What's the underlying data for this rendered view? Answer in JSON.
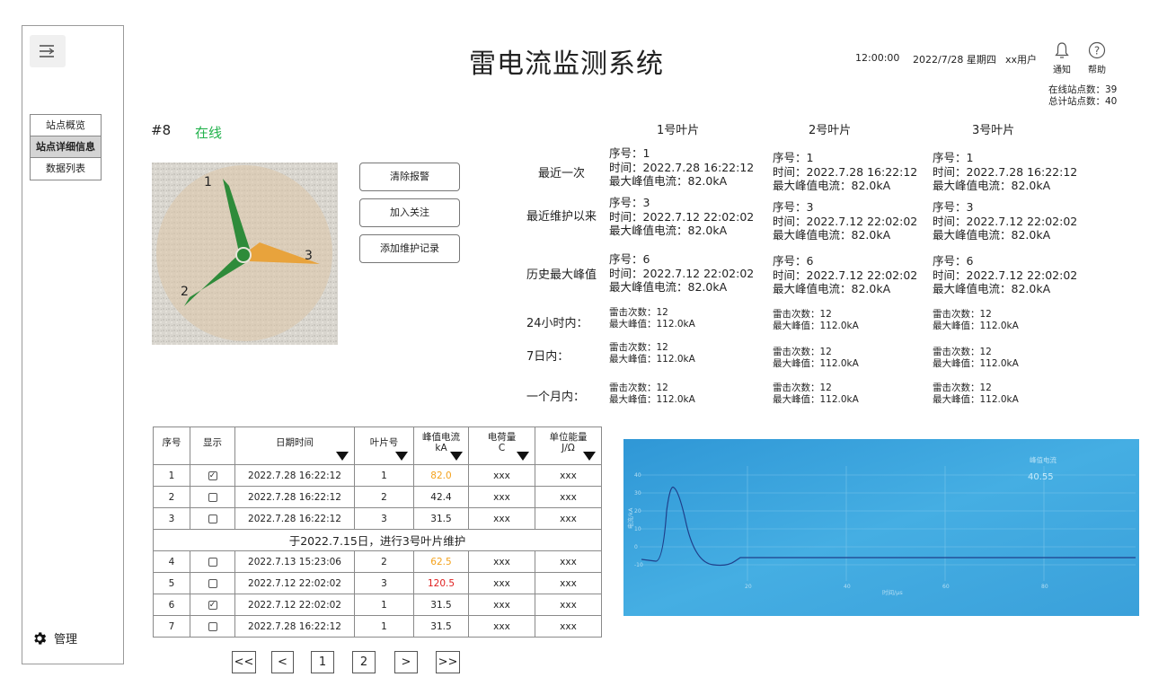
{
  "app": {
    "title": "雷电流监测系统"
  },
  "header": {
    "time": "12:00:00",
    "date": "2022/7/28 星期四",
    "user": "xx用户",
    "notify_label": "通知",
    "help_label": "帮助",
    "online_count": "在线站点数：39",
    "total_count": "总计站点数：40"
  },
  "sidebar": {
    "items": [
      {
        "label": "站点概览"
      },
      {
        "label": "站点详细信息"
      },
      {
        "label": "数据列表"
      }
    ],
    "manage_label": "管理"
  },
  "station": {
    "id": "#8",
    "status": "在线",
    "status_color": "#22b24c"
  },
  "turbine": {
    "blade_labels": [
      "1",
      "2",
      "3"
    ],
    "highlight_blade": "3",
    "normal_color": "#2e8b3a",
    "alert_color": "#e8a33c"
  },
  "actions": {
    "clear_alarm": "清除报警",
    "follow": "加入关注",
    "add_maintenance": "添加维护记录"
  },
  "summary": {
    "blade_headers": [
      "1号叶片",
      "2号叶片",
      "3号叶片"
    ],
    "row_labels": {
      "recent": "最近一次",
      "since_maint": "最近维护以来",
      "hist_max": "历史最大峰值",
      "h24": "24小时内：",
      "d7": "7日内：",
      "m1": "一个月内："
    },
    "blades": [
      {
        "recent": {
          "seq": "序号：1",
          "time": "时间：2022.7.28 16:22:12",
          "peak": "最大峰值电流：82.0kA"
        },
        "since_maint": {
          "seq": "序号：3",
          "time": "时间：2022.7.12 22:02:02",
          "peak": "最大峰值电流：82.0kA"
        },
        "hist_max": {
          "seq": "序号：6",
          "time": "时间：2022.7.12 22:02:02",
          "peak": "最大峰值电流：82.0kA"
        },
        "h24": {
          "count": "雷击次数：12",
          "peak": "最大峰值：112.0kA"
        },
        "d7": {
          "count": "雷击次数：12",
          "peak": "最大峰值：112.0kA"
        },
        "m1": {
          "count": "雷击次数：12",
          "peak": "最大峰值：112.0kA"
        }
      },
      {
        "recent": {
          "seq": "序号：1",
          "time": "时间：2022.7.28 16:22:12",
          "peak": "最大峰值电流：82.0kA"
        },
        "since_maint": {
          "seq": "序号：3",
          "time": "时间：2022.7.12 22:02:02",
          "peak": "最大峰值电流：82.0kA"
        },
        "hist_max": {
          "seq": "序号：6",
          "time": "时间：2022.7.12 22:02:02",
          "peak": "最大峰值电流：82.0kA"
        },
        "h24": {
          "count": "雷击次数：12",
          "peak": "最大峰值：112.0kA"
        },
        "d7": {
          "count": "雷击次数：12",
          "peak": "最大峰值：112.0kA"
        },
        "m1": {
          "count": "雷击次数：12",
          "peak": "最大峰值：112.0kA"
        }
      },
      {
        "recent": {
          "seq": "序号：1",
          "time": "时间：2022.7.28 16:22:12",
          "peak": "最大峰值电流：82.0kA"
        },
        "since_maint": {
          "seq": "序号：3",
          "time": "时间：2022.7.12 22:02:02",
          "peak": "最大峰值电流：82.0kA"
        },
        "hist_max": {
          "seq": "序号：6",
          "time": "时间：2022.7.12 22:02:02",
          "peak": "最大峰值电流：82.0kA"
        },
        "h24": {
          "count": "雷击次数：12",
          "peak": "最大峰值：112.0kA"
        },
        "d7": {
          "count": "雷击次数：12",
          "peak": "最大峰值：112.0kA"
        },
        "m1": {
          "count": "雷击次数：12",
          "peak": "最大峰值：112.0kA"
        }
      }
    ]
  },
  "table": {
    "headers": {
      "seq": "序号",
      "show": "显示",
      "datetime": "日期时间",
      "blade": "叶片号",
      "peak": [
        "峰值电流",
        "kA"
      ],
      "charge": [
        "电荷量",
        "C"
      ],
      "energy": [
        "单位能量",
        "J/Ω"
      ]
    },
    "rows_before": [
      {
        "seq": "1",
        "checked": true,
        "datetime": "2022.7.28 16:22:12",
        "blade": "1",
        "peak": "82.0",
        "level": "orange",
        "charge": "xxx",
        "energy": "xxx"
      },
      {
        "seq": "2",
        "checked": false,
        "datetime": "2022.7.28 16:22:12",
        "blade": "2",
        "peak": "42.4",
        "level": "normal",
        "charge": "xxx",
        "energy": "xxx"
      },
      {
        "seq": "3",
        "checked": false,
        "datetime": "2022.7.28 16:22:12",
        "blade": "3",
        "peak": "31.5",
        "level": "normal",
        "charge": "xxx",
        "energy": "xxx"
      }
    ],
    "maintenance_note": "于2022.7.15日，进行3号叶片维护",
    "rows_after": [
      {
        "seq": "4",
        "checked": false,
        "datetime": "2022.7.13 15:23:06",
        "blade": "2",
        "peak": "62.5",
        "level": "orange",
        "charge": "xxx",
        "energy": "xxx"
      },
      {
        "seq": "5",
        "checked": false,
        "datetime": "2022.7.12 22:02:02",
        "blade": "3",
        "peak": "120.5",
        "level": "red",
        "charge": "xxx",
        "energy": "xxx"
      },
      {
        "seq": "6",
        "checked": true,
        "datetime": "2022.7.12 22:02:02",
        "blade": "1",
        "peak": "31.5",
        "level": "normal",
        "charge": "xxx",
        "energy": "xxx"
      },
      {
        "seq": "7",
        "checked": false,
        "datetime": "2022.7.28 16:22:12",
        "blade": "1",
        "peak": "31.5",
        "level": "normal",
        "charge": "xxx",
        "energy": "xxx"
      }
    ],
    "level_colors": {
      "orange": "#f4a21c",
      "red": "#e02020"
    }
  },
  "pagination": {
    "first": "<<",
    "prev": "<",
    "pages": [
      "1",
      "2"
    ],
    "next": ">",
    "last": ">>"
  },
  "waveform": {
    "screen_color": "#3aa3de",
    "readout_label": "峰值电流",
    "readout_value": "40.55",
    "y_ticks": [
      "40",
      "30",
      "20",
      "10",
      "0",
      "-10"
    ],
    "x_ticks": [
      "20",
      "40",
      "60",
      "80"
    ],
    "x_label": "时间/μs",
    "y_label": "电流/kA"
  }
}
